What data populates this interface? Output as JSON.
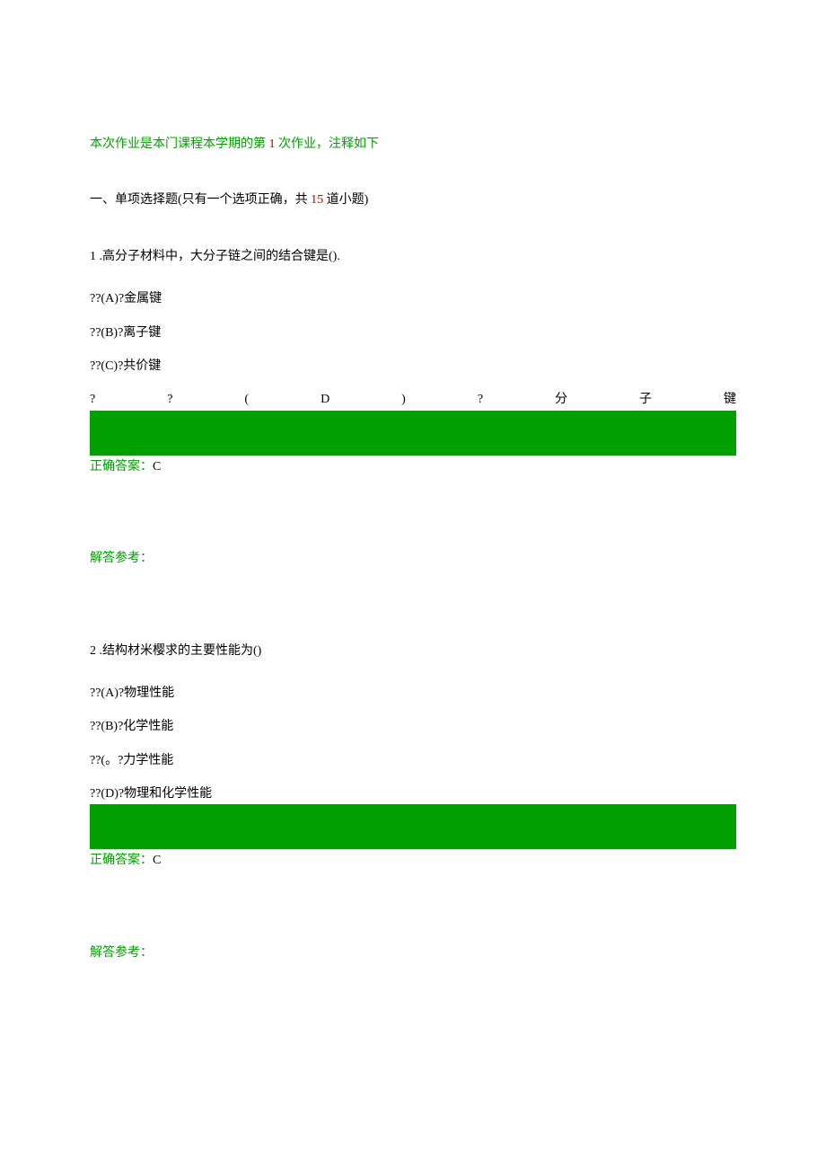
{
  "header_prefix": "本次作业是本门课程本学期的第 ",
  "header_num": "1",
  "header_suffix": " 次作业，注释如下",
  "section_prefix": "一、单项选择题(只有一个选项正确，共 ",
  "section_num": "15",
  "section_suffix": " 道小题)",
  "q1": {
    "num": "1",
    "text": " .高分子材料中，大分子链之间的结合键是().",
    "opt_a": "??(A)?金属键",
    "opt_b": "??(B)?离子键",
    "opt_c": "??(C)?共价键",
    "opt_d_parts": [
      "?",
      "?",
      "(",
      "D",
      ")",
      "?",
      "分",
      "子",
      "键"
    ],
    "answer_label": "正确答案：",
    "answer": "C",
    "explain": "解答参考："
  },
  "q2": {
    "num": "2",
    "text": " .结构材米樱求的主要性能为()",
    "opt_a": "??(A)?物理性能",
    "opt_b": "??(B)?化学性能",
    "opt_c": "??(。?力学性能",
    "opt_d": "??(D)?物理和化学性能",
    "answer_label": "正确答案：",
    "answer": "C",
    "explain": "解答参考："
  }
}
